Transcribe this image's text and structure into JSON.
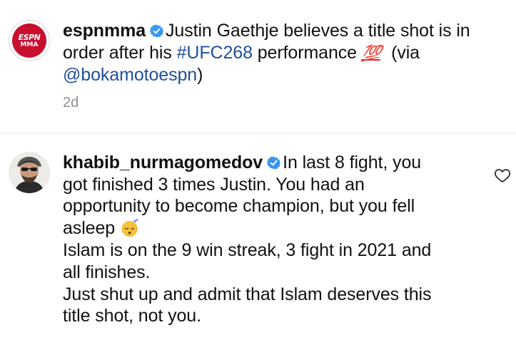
{
  "post": {
    "author": "espnmma",
    "avatar_top": "ESPN",
    "avatar_bottom": "MMA",
    "caption_part1": "Justin Gaethje believes a title shot is in",
    "caption_line2_pre": "order after his ",
    "hashtag": "#UFC268",
    "caption_line2_post": " performance ",
    "emoji_100": "💯",
    "via_pre": "(via",
    "mention": "@bokamotoespn",
    "via_post": ")",
    "time": "2d"
  },
  "comment": {
    "author": "khabib_nurmagomedov",
    "line1": "In last 8 fight, you",
    "line2": "got finished 3 times Justin.  You had an",
    "line3": "opportunity to become champion, but you fell",
    "line4": "asleep",
    "line5": "Islam is on the 9 win streak, 3 fight in 2021 and",
    "line6": "all finishes.",
    "line7": "Just shut up and admit that Islam deserves this",
    "line8": "title shot, not you.",
    "sleepy_emoji": "sleeping-face-icon",
    "like_icon": "heart-outline-icon"
  },
  "colors": {
    "link": "#1f4f9b",
    "verified": "#3897f0",
    "espn_red": "#c8102e",
    "timestamp": "#8e8e8e"
  }
}
